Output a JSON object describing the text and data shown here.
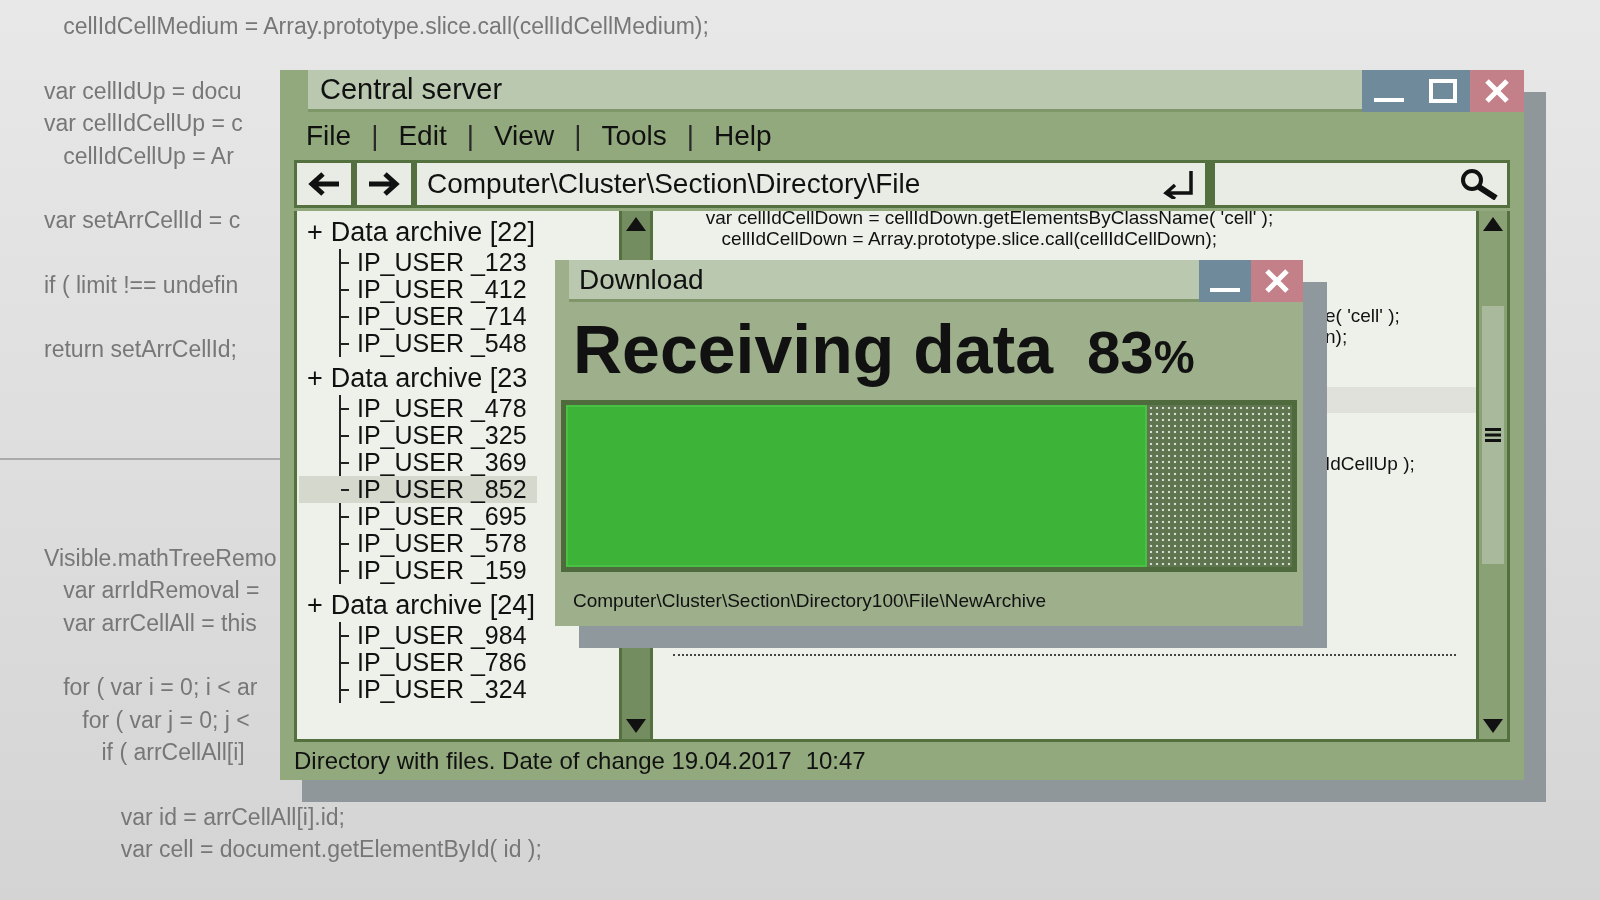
{
  "background_code": {
    "blocks": [
      {
        "kind": "code",
        "lines": [
          "   cellIdCellMedium = Array.prototype.slice.call(cellIdCellMedium);"
        ]
      },
      {
        "kind": "code",
        "lines": [
          "var cellIdUp = docu",
          "var cellIdCellUp = c",
          "   cellIdCellUp = Ar"
        ]
      },
      {
        "kind": "code",
        "lines": [
          "var setArrCellId = c"
        ]
      },
      {
        "kind": "code",
        "lines": [
          "if ( limit !== undefin"
        ]
      },
      {
        "kind": "code",
        "lines": [
          "return setArrCellId;"
        ]
      },
      {
        "kind": "rule"
      },
      {
        "kind": "code",
        "lines": [
          "Visible.mathTreeRemo",
          "   var arrIdRemoval =",
          "   var arrCellAll = this"
        ]
      },
      {
        "kind": "code",
        "lines": [
          "   for ( var i = 0; i < ar",
          "      for ( var j = 0; j <",
          "         if ( arrCellAll[i]"
        ]
      },
      {
        "kind": "code",
        "lines": [
          "            var id = arrCellAll[i].id;",
          "            var cell = document.getElementById( id );"
        ]
      }
    ]
  },
  "window": {
    "title": "Central server",
    "menu": [
      {
        "kind": "item",
        "label": "File"
      },
      {
        "kind": "separator",
        "label": "|"
      },
      {
        "kind": "item",
        "label": "Edit"
      },
      {
        "kind": "separator",
        "label": "|"
      },
      {
        "kind": "item",
        "label": "View"
      },
      {
        "kind": "separator",
        "label": "|"
      },
      {
        "kind": "item",
        "label": "Tools"
      },
      {
        "kind": "separator",
        "label": "|"
      },
      {
        "kind": "item",
        "label": "Help"
      }
    ],
    "address": "Computer\\Cluster\\Section\\Directory\\File",
    "tree": [
      {
        "toggle": "+",
        "label": "Data archive [22]",
        "children": [
          {
            "label": "IP_USER _123",
            "selected": false
          },
          {
            "label": "IP_USER _412",
            "selected": false
          },
          {
            "label": "IP_USER _714",
            "selected": false
          },
          {
            "label": "IP_USER _548",
            "selected": false
          }
        ]
      },
      {
        "toggle": "+",
        "label": "Data archive [23",
        "children": [
          {
            "label": "IP_USER _478",
            "selected": false
          },
          {
            "label": "IP_USER _325",
            "selected": false
          },
          {
            "label": "IP_USER _369",
            "selected": false
          },
          {
            "label": "IP_USER _852",
            "selected": true
          },
          {
            "label": "IP_USER _695",
            "selected": false
          },
          {
            "label": "IP_USER _578",
            "selected": false
          },
          {
            "label": "IP_USER _159",
            "selected": false
          }
        ]
      },
      {
        "toggle": "+",
        "label": "Data archive [24]",
        "children": [
          {
            "label": "IP_USER _984",
            "selected": false
          },
          {
            "label": "IP_USER _786",
            "selected": false
          },
          {
            "label": "IP_USER _324",
            "selected": false
          }
        ]
      }
    ],
    "code": [
      {
        "kind": "full",
        "text": "          var cellIdCellDown = cellIdDown.getElementsByClassName( 'cell' );"
      },
      {
        "kind": "full",
        "text": "             cellIdCellDown = Array.prototype.slice.call(cellIdCellDown);"
      },
      {
        "kind": "partial",
        "text": "e( 'cell' );"
      },
      {
        "kind": "partial",
        "text": "n);"
      },
      {
        "kind": "band"
      },
      {
        "kind": "partial",
        "text": "IdCellUp );"
      },
      {
        "kind": "dots"
      }
    ],
    "status_bar": {
      "text": "Directory with files. Date of change 19.04.2017",
      "time": "10:47"
    }
  },
  "dialog": {
    "title": "Download",
    "heading": "Receiving data",
    "value": "83",
    "unit": "%",
    "level": 0.8,
    "path": "Computer\\Cluster\\Section\\Directory100\\File\\NewArchive"
  }
}
